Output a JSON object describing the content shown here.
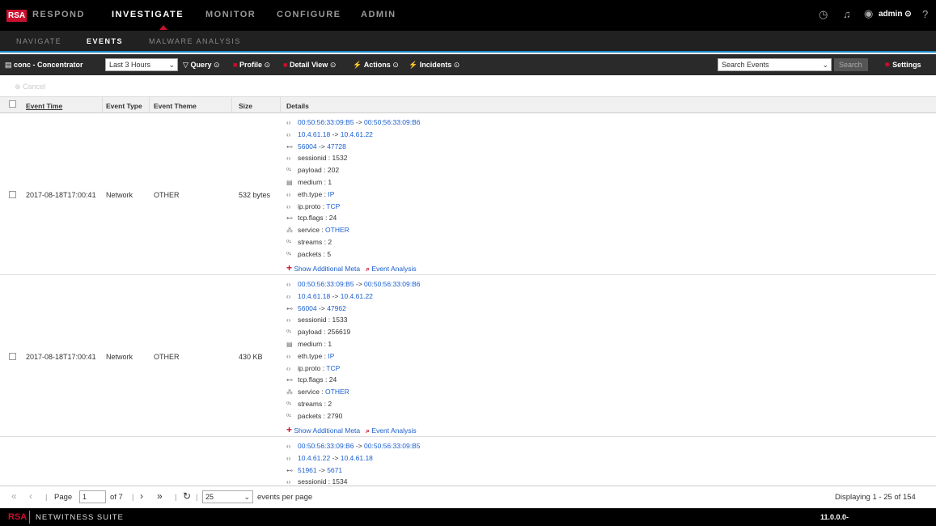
{
  "topnav": {
    "logo": "RSA",
    "items": [
      "RESPOND",
      "INVESTIGATE",
      "MONITOR",
      "CONFIGURE",
      "ADMIN"
    ],
    "active": "INVESTIGATE",
    "user": "admin"
  },
  "subnav": {
    "items": [
      "NAVIGATE",
      "EVENTS",
      "MALWARE ANALYSIS"
    ],
    "active": "EVENTS"
  },
  "toolbar": {
    "service": "conc - Concentrator",
    "time_range": "Last 3 Hours",
    "query": "Query",
    "profile": "Profile",
    "detail_view": "Detail View",
    "actions": "Actions",
    "incidents": "Incidents",
    "search_placeholder": "Search Events",
    "search_button": "Search",
    "settings": "Settings"
  },
  "cancel_label": "Cancel",
  "columns": [
    "Event Time",
    "Event Type",
    "Event Theme",
    "Size",
    "Details"
  ],
  "rows": [
    {
      "time": "2017-08-18T17:00:41",
      "type": "Network",
      "theme": "OTHER",
      "size": "532 bytes",
      "mac_src": "00:50:56:33:09:B5",
      "mac_dst": "00:50:56:33:09:B6",
      "ip_src": "10.4.61.18",
      "ip_dst": "10.4.61.22",
      "port_src": "56004",
      "port_dst": "47728",
      "sessionid": "1532",
      "payload": "202",
      "medium": "1",
      "eth_type": "IP",
      "ip_proto": "TCP",
      "tcp_flags": "24",
      "service": "OTHER",
      "streams": "2",
      "packets": "5"
    },
    {
      "time": "2017-08-18T17:00:41",
      "type": "Network",
      "theme": "OTHER",
      "size": "430 KB",
      "mac_src": "00:50:56:33:09:B5",
      "mac_dst": "00:50:56:33:09:B6",
      "ip_src": "10.4.61.18",
      "ip_dst": "10.4.61.22",
      "port_src": "56004",
      "port_dst": "47962",
      "sessionid": "1533",
      "payload": "256619",
      "medium": "1",
      "eth_type": "IP",
      "ip_proto": "TCP",
      "tcp_flags": "24",
      "service": "OTHER",
      "streams": "2",
      "packets": "2790"
    },
    {
      "mac_src": "00:50:56:33:09:B6",
      "mac_dst": "00:50:56:33:09:B5",
      "ip_src": "10.4.61.22",
      "ip_dst": "10.4.61.18",
      "port_src": "51961",
      "port_dst": "5671",
      "sessionid": "1534"
    }
  ],
  "labels": {
    "sessionid": "sessionid",
    "payload": "payload",
    "medium": "medium",
    "eth_type": "eth.type",
    "ip_proto": "ip.proto",
    "tcp_flags": "tcp.flags",
    "service": "service",
    "streams": "streams",
    "packets": "packets",
    "show_meta": "Show Additional Meta",
    "event_analysis": "Event Analysis",
    "arrow": "->"
  },
  "pager": {
    "page_label": "Page",
    "page": "1",
    "of": "of 7",
    "per_page": "25",
    "per_page_label": "events per page",
    "displaying": "Displaying 1 - 25 of 154"
  },
  "footer": {
    "logo": "RSA",
    "product": "NETWITNESS SUITE",
    "version": "11.0.0.0-"
  },
  "colors": {
    "brand": "#c8102e",
    "link": "#1a5fcf",
    "accent": "#1e88c7"
  }
}
